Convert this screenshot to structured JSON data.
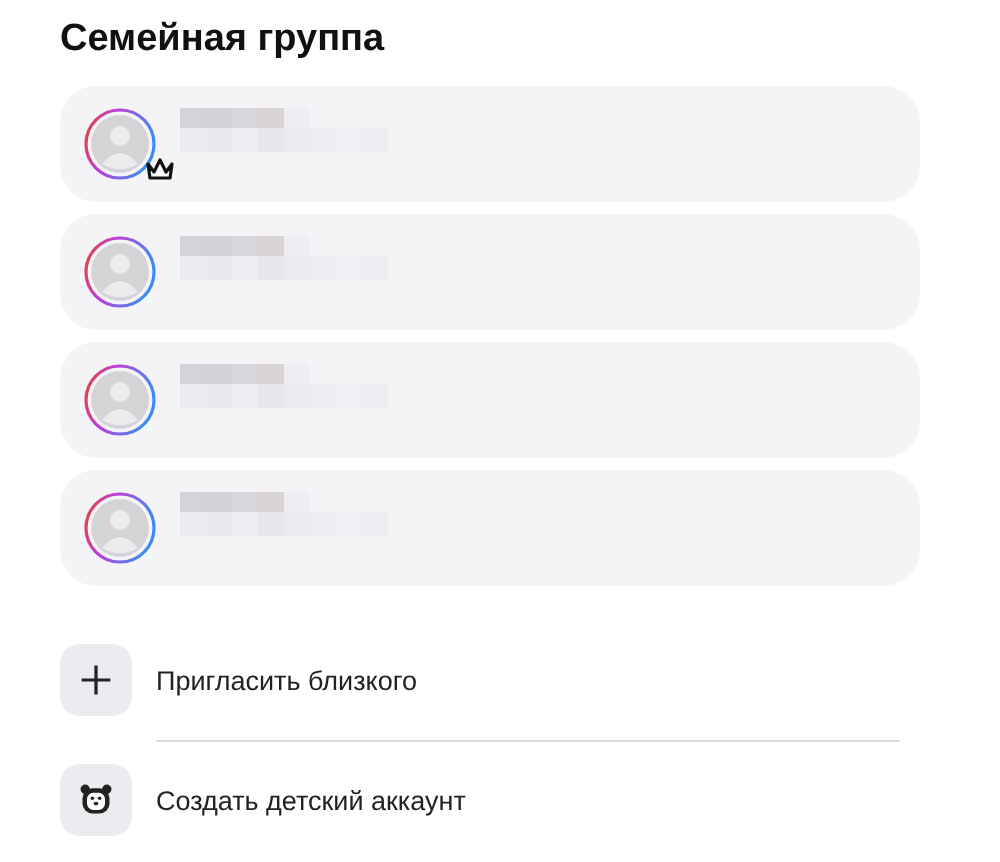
{
  "title": "Семейная группа",
  "members": [
    {
      "owner": true
    },
    {
      "owner": false
    },
    {
      "owner": false
    },
    {
      "owner": false
    }
  ],
  "actions": [
    {
      "kind": "invite",
      "label": "Пригласить близкого"
    },
    {
      "kind": "child",
      "label": "Создать детский аккаунт"
    }
  ]
}
